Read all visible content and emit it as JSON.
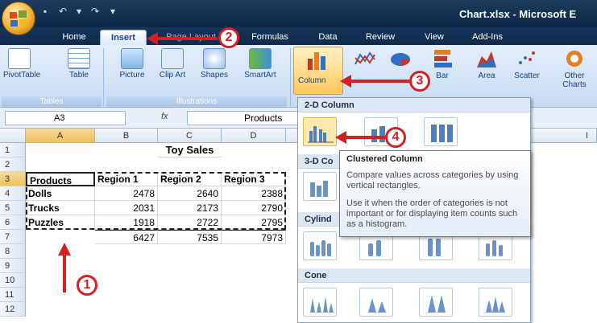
{
  "window": {
    "title": "Chart.xlsx - Microsoft E"
  },
  "tabs": [
    {
      "label": "Home"
    },
    {
      "label": "Insert"
    },
    {
      "label": "Page Layout"
    },
    {
      "label": "Formulas"
    },
    {
      "label": "Data"
    },
    {
      "label": "Review"
    },
    {
      "label": "View"
    },
    {
      "label": "Add-Ins"
    }
  ],
  "ribbon": {
    "pivot_table": "PivotTable",
    "table": "Table",
    "picture": "Picture",
    "clip_art": "Clip Art",
    "shapes": "Shapes",
    "smart_art": "SmartArt",
    "column": "Column",
    "bar": "Bar",
    "area": "Area",
    "scatter": "Scatter",
    "other_charts": "Other Charts",
    "groups": {
      "tables": "Tables",
      "illustrations": "Illustrations"
    }
  },
  "formula_bar": {
    "name_box": "A3",
    "fx": "fx",
    "content": "Products"
  },
  "sheet": {
    "columns": [
      "A",
      "B",
      "C",
      "D"
    ],
    "rows": [
      "1",
      "2",
      "3",
      "4",
      "5",
      "6",
      "7",
      "8",
      "9",
      "10",
      "11",
      "12"
    ],
    "title": "Toy Sales",
    "headers": [
      "Products",
      "Region 1",
      "Region 2",
      "Region 3"
    ],
    "data": [
      [
        "Dolls",
        "2478",
        "2640",
        "2388"
      ],
      [
        "Trucks",
        "2031",
        "2173",
        "2790"
      ],
      [
        "Puzzles",
        "1918",
        "2722",
        "2795"
      ]
    ],
    "totals": [
      "6427",
      "7535",
      "7973"
    ],
    "extra_col": "I"
  },
  "gallery": {
    "sections": {
      "column2d": "2-D Column",
      "column3d": "3-D Co",
      "cylinder": "Cylind",
      "cone": "Cone"
    }
  },
  "tooltip": {
    "title": "Clustered Column",
    "line1": "Compare values across categories by using vertical rectangles.",
    "line2": "Use it when the order of categories is not important or for displaying item counts such as a histogram."
  },
  "callouts": [
    "1",
    "2",
    "3",
    "4"
  ],
  "colors": {
    "callout": "#d42020",
    "ribbon": "#c8daf2",
    "titlebar": "#1e3a5f"
  }
}
